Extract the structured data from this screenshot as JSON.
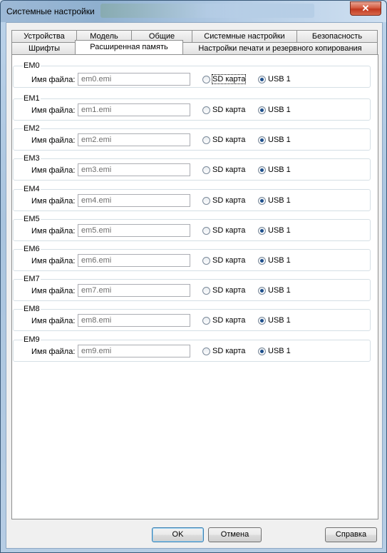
{
  "window": {
    "title": "Системные настройки",
    "close_label": "✕"
  },
  "tabs": {
    "row1": [
      "Устройства",
      "Модель",
      "Общие",
      "Системные настройки",
      "Безопасность"
    ],
    "row2": [
      "Шрифты",
      "Расширенная память",
      "Настройки печати и резервного копирования"
    ],
    "active": "Расширенная память"
  },
  "memory_slots": [
    {
      "name": "EM0",
      "label": "Имя файла:",
      "value": "em0.emi",
      "sd_label": "SD карта",
      "usb_label": "USB 1",
      "selected": "USB 1"
    },
    {
      "name": "EM1",
      "label": "Имя файла:",
      "value": "em1.emi",
      "sd_label": "SD карта",
      "usb_label": "USB 1",
      "selected": "USB 1"
    },
    {
      "name": "EM2",
      "label": "Имя файла:",
      "value": "em2.emi",
      "sd_label": "SD карта",
      "usb_label": "USB 1",
      "selected": "USB 1"
    },
    {
      "name": "EM3",
      "label": "Имя файла:",
      "value": "em3.emi",
      "sd_label": "SD карта",
      "usb_label": "USB 1",
      "selected": "USB 1"
    },
    {
      "name": "EM4",
      "label": "Имя файла:",
      "value": "em4.emi",
      "sd_label": "SD карта",
      "usb_label": "USB 1",
      "selected": "USB 1"
    },
    {
      "name": "EM5",
      "label": "Имя файла:",
      "value": "em5.emi",
      "sd_label": "SD карта",
      "usb_label": "USB 1",
      "selected": "USB 1"
    },
    {
      "name": "EM6",
      "label": "Имя файла:",
      "value": "em6.emi",
      "sd_label": "SD карта",
      "usb_label": "USB 1",
      "selected": "USB 1"
    },
    {
      "name": "EM7",
      "label": "Имя файла:",
      "value": "em7.emi",
      "sd_label": "SD карта",
      "usb_label": "USB 1",
      "selected": "USB 1"
    },
    {
      "name": "EM8",
      "label": "Имя файла:",
      "value": "em8.emi",
      "sd_label": "SD карта",
      "usb_label": "USB 1",
      "selected": "USB 1"
    },
    {
      "name": "EM9",
      "label": "Имя файла:",
      "value": "em9.emi",
      "sd_label": "SD карта",
      "usb_label": "USB 1",
      "selected": "USB 1"
    }
  ],
  "buttons": {
    "ok": "OK",
    "cancel": "Отмена",
    "help": "Справка"
  }
}
